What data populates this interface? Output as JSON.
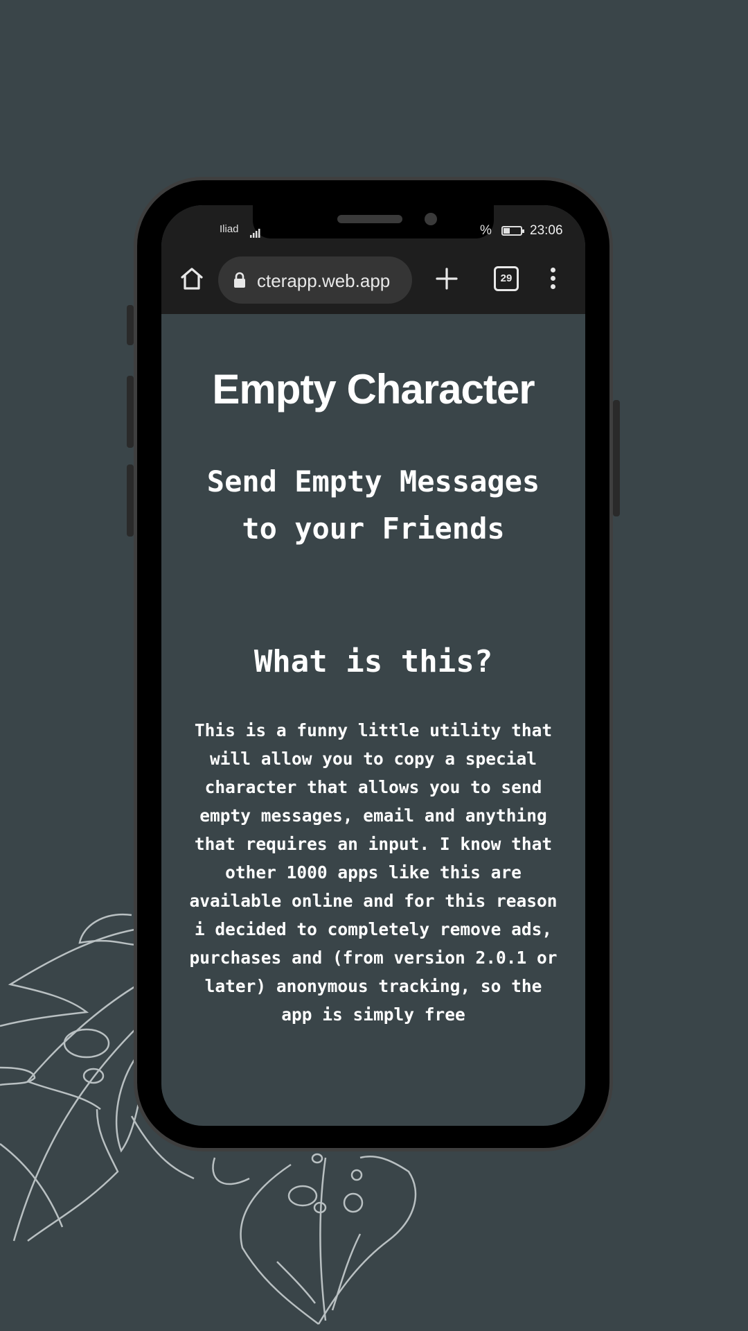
{
  "colors": {
    "background": "#3a4549",
    "browser_bar": "#1e1e1e",
    "text": "#ffffff",
    "leaf_outline": "#b9c0c2"
  },
  "status_bar": {
    "carrier": "Iliad",
    "battery_percent": "%",
    "time": "23:06"
  },
  "browser": {
    "url": "cterapp.web.app",
    "tab_count": "29",
    "icons": [
      "home-icon",
      "lock-icon",
      "new-tab-icon",
      "tabs-icon",
      "menu-icon"
    ]
  },
  "page": {
    "title": "Empty Character",
    "subtitle": "Send Empty Messages to your Friends",
    "section_heading": "What is this?",
    "body": "This is a funny little utility that will allow you to copy a special character that allows you to send empty messages, email and anything that requires an input. I know that other 1000 apps like this are available online and for this reason i decided to completely remove ads, purchases and (from version 2.0.1 or later) anonymous tracking, so the app is simply free"
  }
}
